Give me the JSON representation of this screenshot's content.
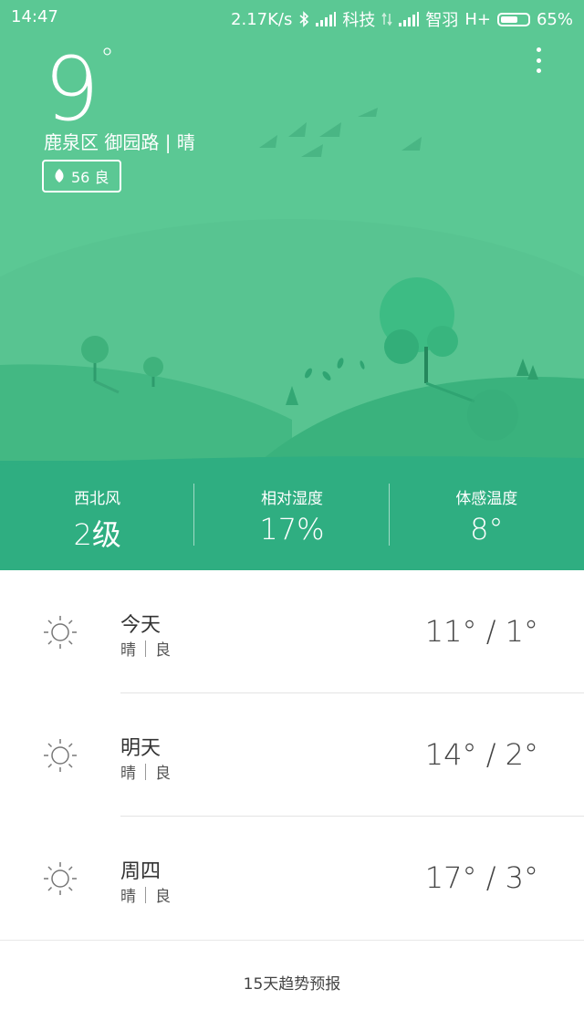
{
  "status_bar": {
    "time": "14:47",
    "speed": "2.17K/s",
    "carrier1": "科技",
    "carrier2": "智羽",
    "network": "H+",
    "battery": "65%",
    "battery_level": 0.65
  },
  "current": {
    "temperature": "9",
    "degree": "°",
    "location": "鹿泉区  御园路 | 晴",
    "aqi": "56 良"
  },
  "stats": [
    {
      "label": "西北风",
      "value": "2级"
    },
    {
      "label": "相对湿度",
      "value": "17%"
    },
    {
      "label": "体感温度",
      "value": "8°"
    }
  ],
  "forecast": [
    {
      "day": "今天",
      "weather": "晴",
      "quality": "良",
      "range": "11° / 1°"
    },
    {
      "day": "明天",
      "weather": "晴",
      "quality": "良",
      "range": "14° / 2°"
    },
    {
      "day": "周四",
      "weather": "晴",
      "quality": "良",
      "range": "17° / 3°"
    }
  ],
  "footer": {
    "label": "15天趋势预报"
  },
  "colors": {
    "hero": "#5bc894",
    "stats_band": "#2fae81"
  },
  "icons": {
    "menu": "more-vert-icon",
    "aqi": "leaf-icon",
    "weather": "sun-icon"
  }
}
